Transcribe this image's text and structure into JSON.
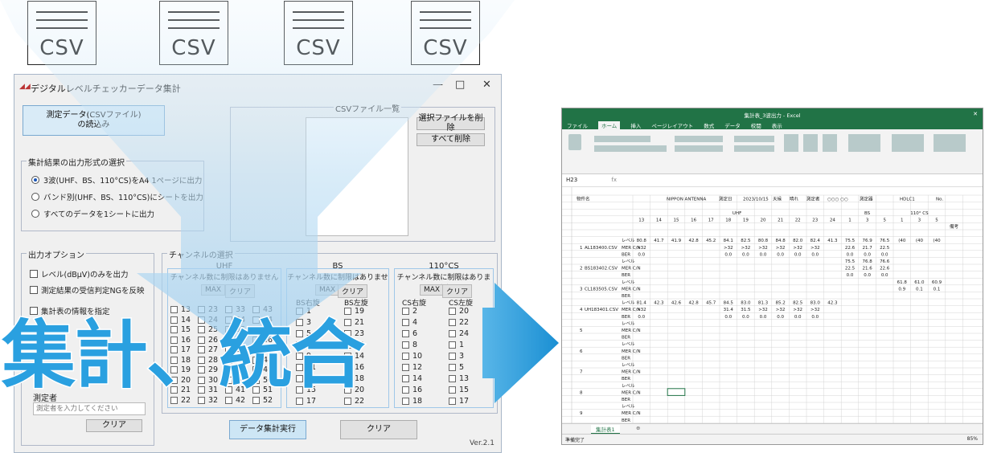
{
  "csv_docs": [
    "CSV",
    "CSV",
    "CSV",
    "CSV"
  ],
  "app": {
    "title": "デジタルレベルチェッカーデータ集計",
    "load_button": "測定データ(CSVファイル)\nの読込み",
    "csv_list_label": "CSVファイル一覧",
    "delete_selected": "選択ファイルを削除",
    "delete_all": "すべて削除",
    "output_group_label": "集計結果の出力形式の選択",
    "output_options": [
      {
        "label": "3波(UHF、BS、110°CS)をA4 1ページに出力",
        "selected": true
      },
      {
        "label": "バンド別(UHF、BS、110°CS)にシートを出力",
        "selected": false
      },
      {
        "label": "すべてのデータを1シートに出力",
        "selected": false
      }
    ],
    "output_options_group_label": "出力オプション",
    "options": [
      "レベル(dBμV)のみを出力",
      "測定結果の受信判定NGを反映",
      "集計表の情報を指定"
    ],
    "channel_group_label": "チャンネルの選択",
    "uhf": {
      "title": "UHF",
      "note": "チャンネル数に制限はありません",
      "max": "MAX",
      "clear": "クリア",
      "channels": [
        "13",
        "14",
        "15",
        "16",
        "17",
        "18",
        "19",
        "20",
        "21",
        "22",
        "23",
        "24",
        "25",
        "26",
        "27",
        "28",
        "29",
        "30",
        "31",
        "32",
        "33",
        "34",
        "35",
        "36",
        "37",
        "38",
        "39",
        "40",
        "41",
        "42",
        "43",
        "44",
        "45",
        "46",
        "47",
        "48",
        "49",
        "50",
        "51",
        "52"
      ]
    },
    "bs": {
      "title": "BS",
      "note": "チャンネル数に制限はありません",
      "max": "MAX",
      "clear": "クリア",
      "right_label": "BS右旋",
      "left_label": "BS左旋",
      "right_channels": [
        "1",
        "3",
        "5",
        "7",
        "9",
        "11",
        "13",
        "15",
        "17"
      ],
      "left_channels": [
        "19",
        "21",
        "23",
        "12",
        "14",
        "16",
        "18",
        "20",
        "22"
      ]
    },
    "cs": {
      "title": "110°CS",
      "note": "チャンネル数に制限はありません",
      "max": "MAX",
      "clear": "クリア",
      "right_label": "CS右旋",
      "left_label": "CS左旋",
      "right_channels": [
        "2",
        "4",
        "6",
        "8",
        "10",
        "12",
        "14",
        "16",
        "18"
      ],
      "left_channels": [
        "20",
        "22",
        "24",
        "1",
        "3",
        "5",
        "13",
        "15",
        "17"
      ]
    },
    "measurer_label": "測定者",
    "measurer_placeholder": "測定者を入力してください",
    "measurer_clear": "クリア",
    "run_button": "データ集計実行",
    "clear_button": "クリア",
    "version": "Ver.2.1"
  },
  "overlay_text": "集計、統合",
  "excel": {
    "title": "集計表_3波出力 - Excel",
    "tabs": [
      "ファイル",
      "ホーム",
      "挿入",
      "ページレイアウト",
      "数式",
      "データ",
      "校閲",
      "表示"
    ],
    "active_tab": "ホーム",
    "cell_ref": "H23",
    "sheet_tab": "集計表1",
    "status_left": "準備完了",
    "zoom": "85%",
    "header": {
      "property_label": "物件名",
      "property_value": "NIPPON ANTENNA",
      "date_label": "測定日",
      "date_value": "2023/10/15",
      "weather_label": "天候",
      "weather_value": "晴れ",
      "measurer_label": "測定者",
      "measurer_value": "○○○ ○○",
      "device_label": "測定器",
      "device_value": "HDLC1",
      "no_label": "No."
    },
    "band_labels": [
      "UHF",
      "BS",
      "110° CS"
    ],
    "channel_row": [
      "13",
      "14",
      "15",
      "16",
      "17",
      "18",
      "19",
      "20",
      "21",
      "22",
      "23",
      "24",
      "1",
      "3",
      "5",
      "1",
      "3",
      "5"
    ],
    "remarks_label": "備考",
    "row_labels": [
      "レベル",
      "MER C/N",
      "BER"
    ],
    "rows": [
      {
        "no": "1",
        "file": "AL183400.CSV",
        "level": [
          "80.8",
          "41.7",
          "41.9",
          "42.8",
          "45.2",
          "84.1",
          "82.5",
          "80.8",
          "84.8",
          "82.0",
          "82.4",
          "41.3",
          "75.5",
          "76.9",
          "76.5",
          "(40",
          "(40",
          "(40"
        ],
        "mer": [
          ">32",
          "",
          "",
          "",
          "",
          ">32",
          ">32",
          ">32",
          ">32",
          ">32",
          ">32",
          "",
          "22.6",
          "21.7",
          "22.5",
          "",
          "",
          ""
        ],
        "ber": [
          "0.0",
          "",
          "",
          "",
          "",
          "0.0",
          "0.0",
          "0.0",
          "0.0",
          "0.0",
          "0.0",
          "",
          "0.0",
          "0.0",
          "0.0",
          "",
          "",
          ""
        ]
      },
      {
        "no": "2",
        "file": "BS183402.CSV",
        "level": [
          "",
          "",
          "",
          "",
          "",
          "",
          "",
          "",
          "",
          "",
          "",
          "",
          "75.5",
          "76.8",
          "76.6",
          "",
          "",
          ""
        ],
        "mer": [
          "",
          "",
          "",
          "",
          "",
          "",
          "",
          "",
          "",
          "",
          "",
          "",
          "22.5",
          "21.6",
          "22.6",
          "",
          "",
          ""
        ],
        "ber": [
          "",
          "",
          "",
          "",
          "",
          "",
          "",
          "",
          "",
          "",
          "",
          "",
          "0.0",
          "0.0",
          "0.0",
          "",
          "",
          ""
        ]
      },
      {
        "no": "3",
        "file": "CL183505.CSV",
        "level": [
          "",
          "",
          "",
          "",
          "",
          "",
          "",
          "",
          "",
          "",
          "",
          "",
          "",
          "",
          "",
          "61.8",
          "61.0",
          "60.9"
        ],
        "mer": [
          "",
          "",
          "",
          "",
          "",
          "",
          "",
          "",
          "",
          "",
          "",
          "",
          "",
          "",
          "",
          "0.9",
          "0.1",
          "0.1"
        ],
        "ber": [
          "",
          "",
          "",
          "",
          "",
          "",
          "",
          "",
          "",
          "",
          "",
          "",
          "",
          "",
          "",
          "",
          "",
          ""
        ]
      },
      {
        "no": "4",
        "file": "UH183401.CSV",
        "level": [
          "81.4",
          "42.3",
          "42.6",
          "42.8",
          "45.7",
          "84.5",
          "83.0",
          "81.3",
          "85.2",
          "82.5",
          "83.0",
          "42.3",
          "",
          "",
          "",
          "",
          "",
          ""
        ],
        "mer": [
          ">32",
          "",
          "",
          "",
          "",
          "31.4",
          "31.5",
          ">32",
          ">32",
          ">32",
          ">32",
          "",
          "",
          "",
          "",
          "",
          "",
          ""
        ],
        "ber": [
          "0.0",
          "",
          "",
          "",
          "",
          "0.0",
          "0.0",
          "0.0",
          "0.0",
          "0.0",
          "0.0",
          "",
          "",
          "",
          "",
          "",
          "",
          ""
        ]
      },
      {
        "no": "5",
        "file": "",
        "level": [],
        "mer": [],
        "ber": []
      },
      {
        "no": "6",
        "file": "",
        "level": [],
        "mer": [],
        "ber": []
      },
      {
        "no": "7",
        "file": "",
        "level": [],
        "mer": [],
        "ber": []
      },
      {
        "no": "8",
        "file": "",
        "level": [],
        "mer": [],
        "ber": []
      },
      {
        "no": "9",
        "file": "",
        "level": [],
        "mer": [],
        "ber": []
      },
      {
        "no": "10",
        "file": "",
        "level": [],
        "mer": [],
        "ber": []
      }
    ],
    "colors": {
      "excel_green": "#217346",
      "selection": "#217346"
    }
  },
  "colors": {
    "overlay_blue": "#2aa0e0",
    "arrow_blue": "#1e9ad8",
    "funnel_light": "#cfe6f7",
    "run_button_bg": "#cde6f5"
  }
}
